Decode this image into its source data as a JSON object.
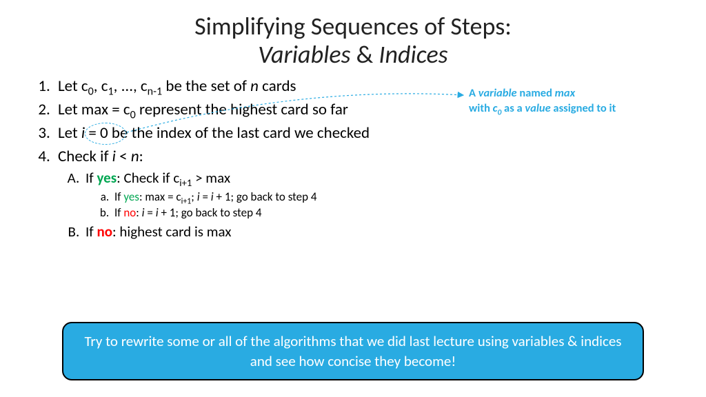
{
  "title": {
    "line1": "Simplifying Sequences of Steps:",
    "line2_a": "Variables",
    "line2_amp": " & ",
    "line2_b": "Indices"
  },
  "steps": {
    "s1_a": "Let c",
    "s1_b": ", c",
    "s1_c": ", ..., c",
    "s1_d": " be the set of ",
    "s1_e": " cards",
    "sub0": "0",
    "sub1": "1",
    "subn1": "n-1",
    "n": "n",
    "s2_a": "Let max = c",
    "s2_b": " represent the highest card so far",
    "s3_a": "Let ",
    "s3_i": "i",
    "s3_b": " = 0 be the index of the last card we checked",
    "s4_a": "Check if ",
    "s4_i": "i",
    "s4_b": " < ",
    "s4_n": "n",
    "s4_c": ":",
    "A_pre": "If ",
    "A_yes": "yes",
    "A_post": ":  Check if c",
    "A_sub": "i+1",
    "A_tail": " > max",
    "a_pre": "If ",
    "a_yes": "yes",
    "a_mid": ": max = c",
    "a_sub": "i+1",
    "a_semi": "; ",
    "a_i1": "i",
    "a_eq": " = ",
    "a_i2": "i",
    "a_tail": " + 1; go back to step 4",
    "b_pre": "If ",
    "b_no": "no",
    "b_mid": ": ",
    "b_i1": "i",
    "b_eq": " = ",
    "b_i2": "i",
    "b_tail": " + 1; go back to step 4",
    "B_pre": "If ",
    "B_no": "no",
    "B_tail": ": highest card is max"
  },
  "annotation": {
    "l1_a": "A ",
    "l1_b": "variable",
    "l1_c": " named ",
    "l1_d": "max",
    "l2_a": "with ",
    "l2_b": "c",
    "l2_sub": "0",
    "l2_c": " as a ",
    "l2_d": "value",
    "l2_e": " assigned to it"
  },
  "callout": "Try to rewrite some or all of the algorithms that we did last lecture using variables & indices and see how concise they become!"
}
